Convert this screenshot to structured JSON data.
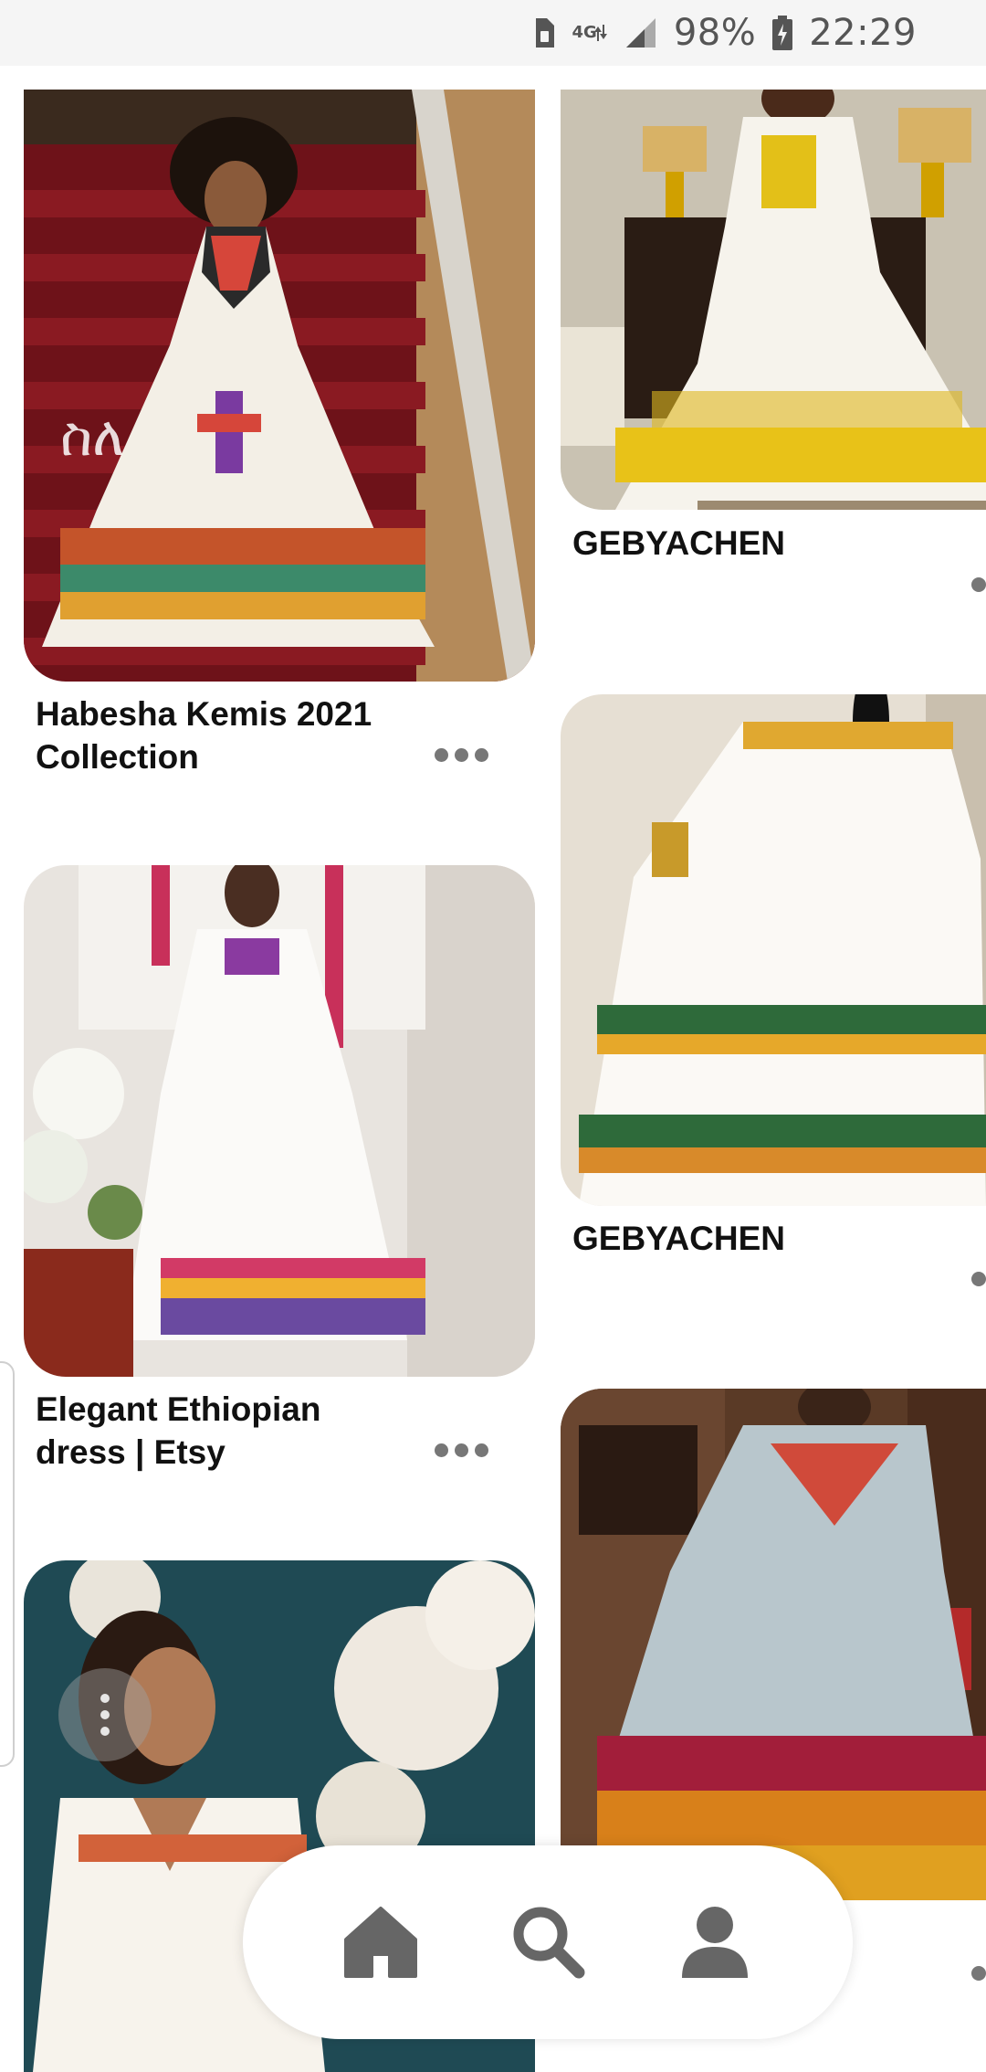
{
  "status_bar": {
    "network": "4G",
    "battery": "98%",
    "time": "22:29",
    "icons": [
      "sim-icon",
      "signal-icon",
      "battery-charging-icon"
    ]
  },
  "feed": {
    "left_column": [
      {
        "title_line1": "",
        "title_line2": "",
        "image": "Woman in white Habesha kemis on red staircase"
      },
      {
        "title_line1": "Habesha Kemis 2021",
        "title_line2": "Collection"
      },
      {
        "title_line1": "Elegant Ethiopian",
        "title_line2": "dress | Etsy"
      }
    ],
    "right_column": [
      {
        "title": "GEBYACHEN"
      },
      {
        "title": "GEBYACHEN"
      }
    ],
    "overlay_text": "ስለ"
  },
  "bottom_nav": {
    "items": [
      "home-icon",
      "search-icon",
      "profile-icon"
    ]
  },
  "colors": {
    "background": "#ffffff",
    "status_bar": "#f5f5f5",
    "icon_gray": "#666666",
    "text": "#111111"
  }
}
